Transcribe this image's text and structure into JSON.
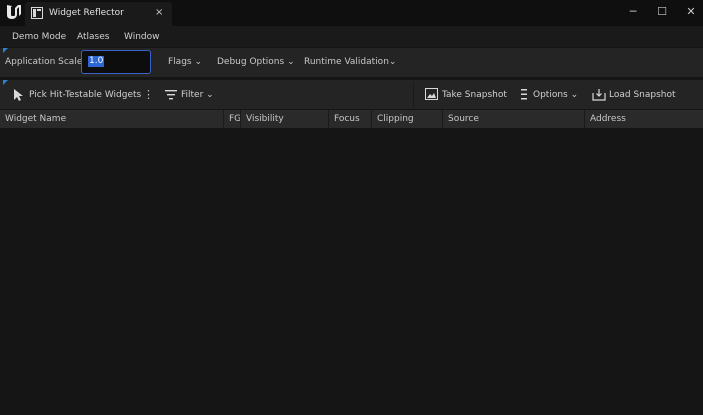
{
  "window": {
    "tab_title": "Widget Reflector",
    "close_glyph": "×",
    "min_glyph": "─",
    "max_glyph": "☐",
    "winclose_glyph": "✕"
  },
  "menu": {
    "items": [
      "Demo Mode",
      "Atlases",
      "Window"
    ]
  },
  "options": {
    "scale_label": "Application Scale:",
    "scale_value": "1.0",
    "flags": "Flags",
    "debug": "Debug Options",
    "runtime": "Runtime Validation"
  },
  "toolbar": {
    "pick": "Pick Hit-Testable Widgets",
    "filter": "Filter",
    "snapshot": "Take Snapshot",
    "options": "Options",
    "load": "Load Snapshot"
  },
  "table": {
    "columns": [
      "Widget Name",
      "FG",
      "Visibility",
      "Focus",
      "Clipping",
      "Source",
      "Address"
    ]
  },
  "colors": {
    "accent": "#2e66d6",
    "background": "#151515"
  }
}
